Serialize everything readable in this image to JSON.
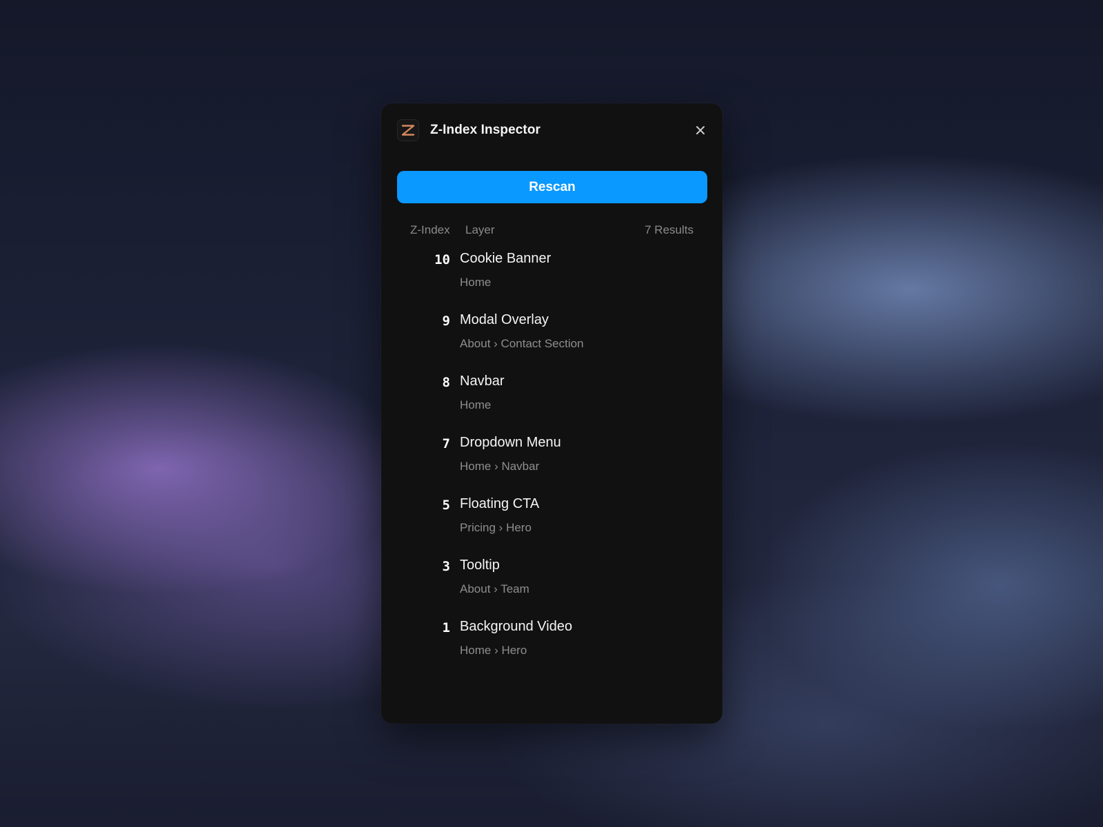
{
  "colors": {
    "panel_bg": "#111111",
    "accent": "#0a99ff",
    "logo_z": "#d58a5e",
    "muted_text": "#8e8e8e"
  },
  "header": {
    "logo_letter": "Z",
    "title": "Z-Index Inspector",
    "close_icon": "close-icon"
  },
  "toolbar": {
    "rescan_label": "Rescan"
  },
  "columns": {
    "zindex": "Z-Index",
    "layer": "Layer",
    "results": "7 Results"
  },
  "layers": [
    {
      "z": "10",
      "name": "Cookie Banner",
      "path": "Home"
    },
    {
      "z": "9",
      "name": "Modal Overlay",
      "path": "About › Contact Section"
    },
    {
      "z": "8",
      "name": "Navbar",
      "path": "Home"
    },
    {
      "z": "7",
      "name": "Dropdown Menu",
      "path": "Home › Navbar"
    },
    {
      "z": "5",
      "name": "Floating CTA",
      "path": "Pricing › Hero"
    },
    {
      "z": "3",
      "name": "Tooltip",
      "path": "About › Team"
    },
    {
      "z": "1",
      "name": "Background Video",
      "path": "Home › Hero"
    }
  ]
}
